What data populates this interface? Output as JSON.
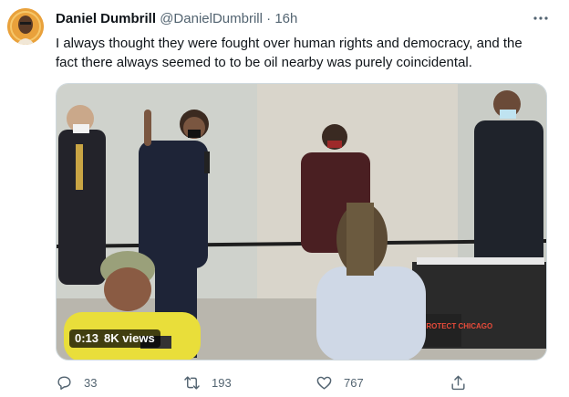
{
  "tweet": {
    "display_name": "Daniel Dumbrill",
    "handle": "@DanielDumbrill",
    "separator": "·",
    "time": "16h",
    "text": "I always thought they were fought over human rights and democracy, and the fact there always seemed to to be oil nearby was purely coincidental.",
    "more_icon": "more-horizontal-icon",
    "video": {
      "duration": "0:13",
      "views": "8K views",
      "sign_text": "PROTECT CHICAGO"
    },
    "actions": {
      "reply_count": "33",
      "retweet_count": "193",
      "like_count": "767",
      "reply_icon": "reply-icon",
      "retweet_icon": "retweet-icon",
      "like_icon": "heart-icon",
      "share_icon": "share-icon"
    }
  },
  "colors": {
    "text": "#0f1419",
    "secondary": "#536471",
    "border": "#cfd9de",
    "avatar_bg": "#e9a13b"
  }
}
